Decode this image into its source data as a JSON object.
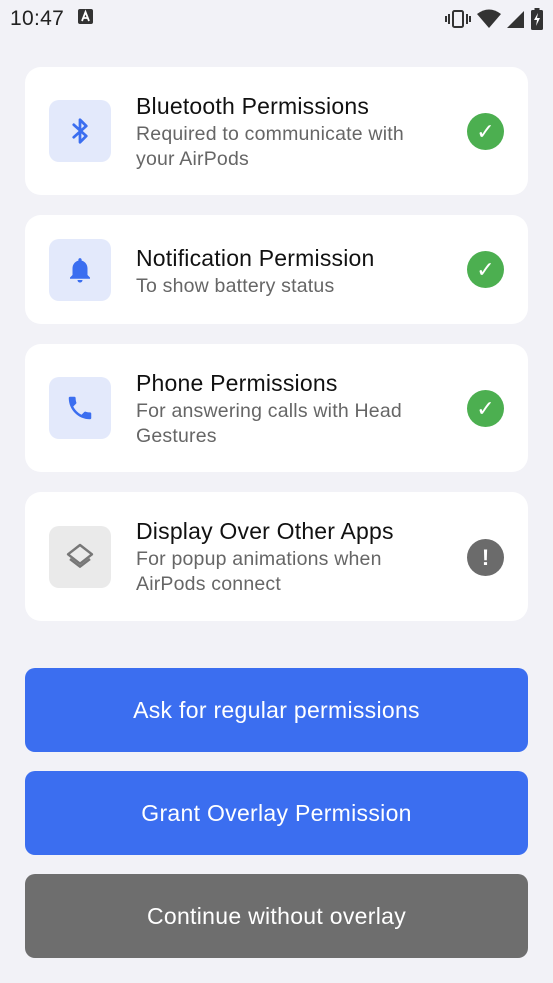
{
  "status_bar": {
    "time": "10:47",
    "notification_icon": "a-box-icon",
    "icons": [
      "vibrate-icon",
      "wifi-icon",
      "signal-icon",
      "battery-charging-icon"
    ]
  },
  "permissions": [
    {
      "title": "Bluetooth Permissions",
      "description": "Required to communicate with your AirPods",
      "icon": "bluetooth-icon",
      "status": "granted",
      "status_glyph": "✓"
    },
    {
      "title": "Notification Permission",
      "description": "To show battery status",
      "icon": "bell-icon",
      "status": "granted",
      "status_glyph": "✓"
    },
    {
      "title": "Phone Permissions",
      "description": "For answering calls with Head Gestures",
      "icon": "phone-icon",
      "status": "granted",
      "status_glyph": "✓"
    },
    {
      "title": "Display Over Other Apps",
      "description": "For popup animations when AirPods connect",
      "icon": "layers-icon",
      "status": "not-granted",
      "status_glyph": "!"
    }
  ],
  "buttons": {
    "regular_permissions": "Ask for regular permissions",
    "overlay_permission": "Grant Overlay Permission",
    "continue_without_overlay": "Continue without overlay"
  },
  "colors": {
    "accent": "#3b6ef0",
    "granted": "#4caf50",
    "not_granted": "#6b6b6b",
    "secondary_button": "#6e6e6e",
    "background": "#f2f2f7"
  }
}
